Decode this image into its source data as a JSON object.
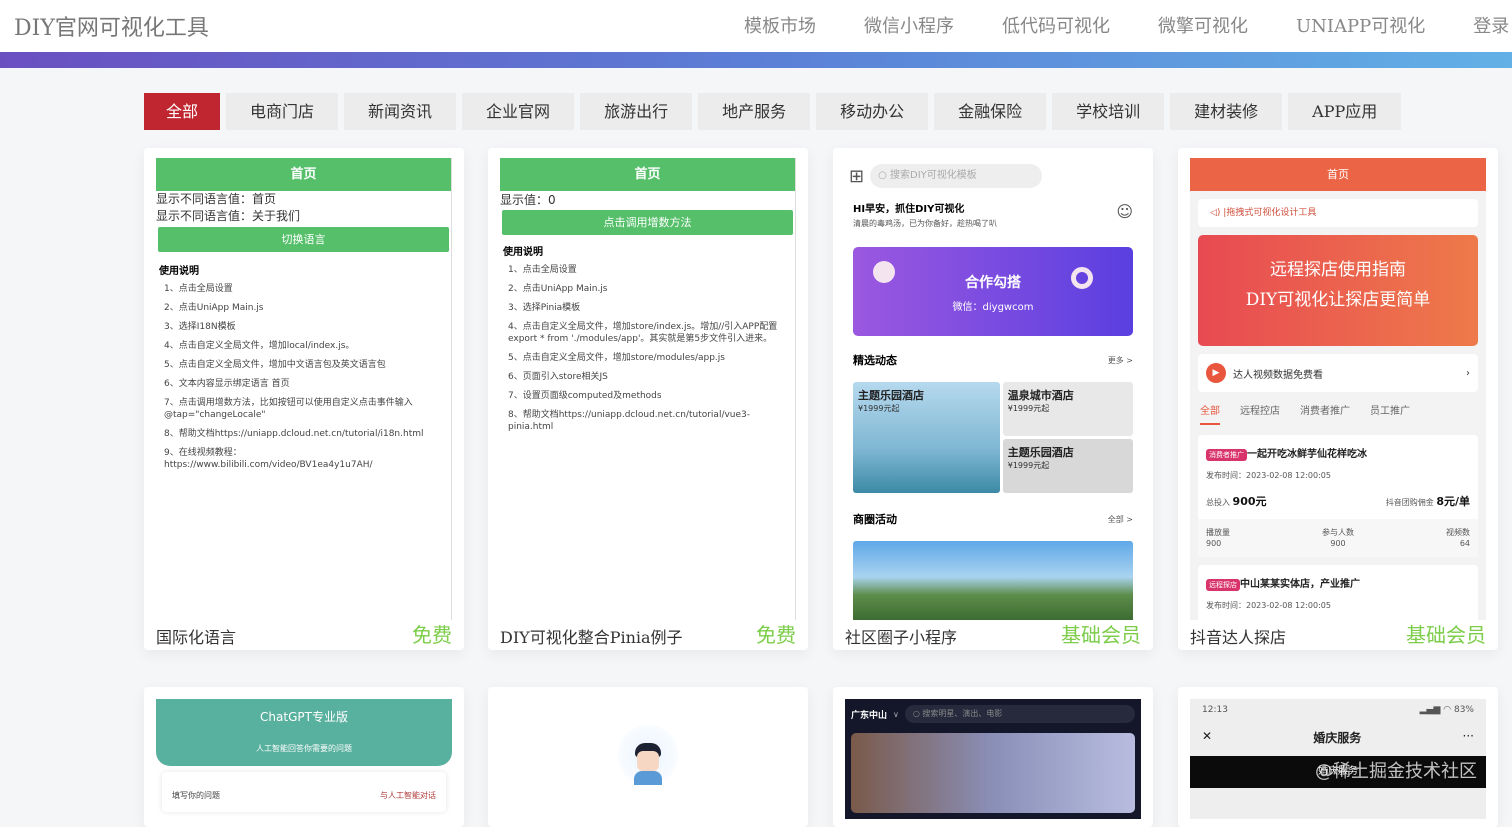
{
  "header": {
    "logo": "DIY官网可视化工具",
    "nav": [
      "模板市场",
      "微信小程序",
      "低代码可视化",
      "微擎可视化",
      "UNIAPP可视化",
      "登录"
    ]
  },
  "categories": [
    "全部",
    "电商门店",
    "新闻资讯",
    "企业官网",
    "旅游出行",
    "地产服务",
    "移动办公",
    "金融保险",
    "学校培训",
    "建材装修",
    "APP应用"
  ],
  "cards": [
    {
      "name": "国际化语言",
      "price": "免费",
      "preview": {
        "title": "首页",
        "lines": [
          "显示不同语言值：首页",
          "显示不同语言值：关于我们"
        ],
        "button": "切换语言",
        "heading": "使用说明",
        "steps": [
          "1、点击全局设置",
          "2、点击UniApp Main.js",
          "3、选择I18N模板",
          "4、点击自定义全局文件，增加local/index.js。",
          "5、点击自定义全局文件，增加中文语言包及英文语言包",
          "6、文本内容显示绑定语言 首页",
          "7、点击调用增数方法，比如按钮可以使用自定义点击事件输入@tap=\"changeLocale\"",
          "8、帮助文档https://uniapp.dcloud.net.cn/tutorial/i18n.html",
          "9、在线视频教程：https://www.bilibili.com/video/BV1ea4y1u7AH/"
        ]
      }
    },
    {
      "name": "DIY可视化整合Pinia例子",
      "price": "免费",
      "preview": {
        "title": "首页",
        "lines": [
          "显示值：0"
        ],
        "button": "点击调用增数方法",
        "heading": "使用说明",
        "steps": [
          "1、点击全局设置",
          "2、点击UniApp Main.js",
          "3、选择Pinia模板",
          "4、点击自定义全局文件，增加store/index.js。增加//引入APP配置export * from './modules/app'。其实就是第5步文件引入进来。",
          "5、点击自定义全局文件，增加store/modules/app.js",
          "6、页面引入store相关JS",
          "7、设置页面级computed及methods",
          "8、帮助文档https://uniapp.dcloud.net.cn/tutorial/vue3-pinia.html"
        ]
      }
    },
    {
      "name": "社区圈子小程序",
      "price": "基础会员",
      "preview": {
        "search": "搜索DIY可视化模板",
        "greet": "HI早安，抓住DIY可视化",
        "sub": "清晨的毒鸡汤，已为你备好，趁热喝了叭",
        "banner_title": "合作勾搭",
        "banner_sub": "微信：diygwcom",
        "section1": "精选动态",
        "more": "更多 >",
        "hotels": [
          {
            "name": "主题乐园酒店",
            "price": "¥1999元起"
          },
          {
            "name": "温泉城市酒店",
            "price": "¥1999元起"
          },
          {
            "name": "主题乐园酒店",
            "price": "¥1999元起"
          }
        ],
        "section2": "商圈活动",
        "all": "全部 >"
      }
    },
    {
      "name": "抖音达人探店",
      "price": "基础会员",
      "preview": {
        "title": "首页",
        "notice": "|拖拽式可视化设计工具",
        "banner1": "远程探店使用指南",
        "banner2": "DIY可视化让探店更简单",
        "video": "达人视频数据免费看",
        "tabs": [
          "全部",
          "远程控店",
          "消费者推广",
          "员工推广"
        ],
        "items": [
          {
            "tag": "消费者推广",
            "title": "一起开吃冰鲜芋仙花样吃冰",
            "time": "发布时间：2023-02-08 12:00:05",
            "invest_label": "总投入",
            "invest": "900元",
            "comm_label": "抖音团购佣金",
            "comm": "8元/单",
            "stats": [
              {
                "k": "播放量",
                "v": "900"
              },
              {
                "k": "参与人数",
                "v": "900"
              },
              {
                "k": "视频数",
                "v": "64"
              }
            ]
          },
          {
            "tag": "远程探店",
            "title": "中山某某实体店，产业推广",
            "time": "发布时间：2023-02-08 12:00:05"
          }
        ]
      }
    }
  ],
  "row2": {
    "chat": {
      "title": "ChatGPT专业版",
      "sub": "人工智能回答你需要的问题",
      "input": "填写你的问题",
      "action": "与人工智能对话"
    },
    "movie": {
      "city": "广东中山",
      "search": "搜索明星、演出、电影"
    },
    "wedding": {
      "time": "12:13",
      "battery": "83%",
      "title": "婚庆服务",
      "banner": "婚庆服务"
    }
  },
  "watermark": "@稀土掘金技术社区",
  "colors": {
    "accent": "#c0262f",
    "green": "#55bf6a",
    "price": "#7ccd4a"
  }
}
